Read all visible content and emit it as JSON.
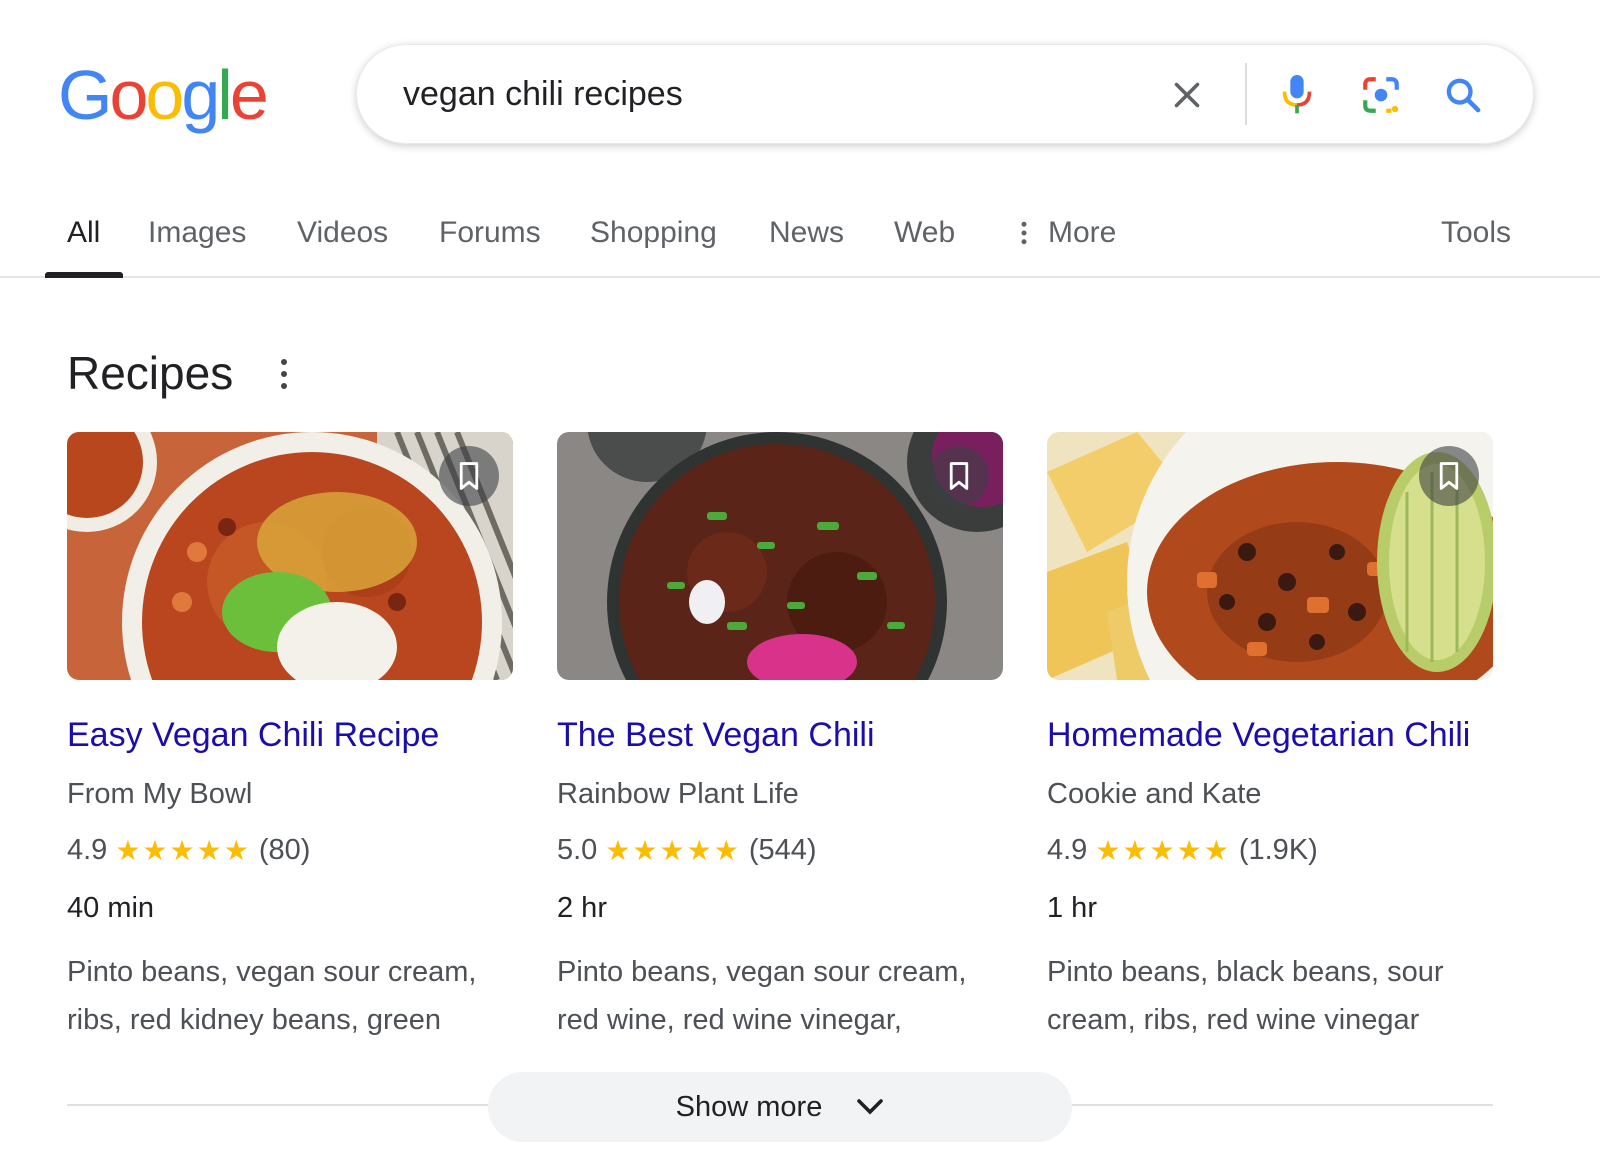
{
  "header": {
    "logo_letters": [
      "G",
      "o",
      "o",
      "g",
      "l",
      "e"
    ],
    "logo_colors": [
      "#4285F4",
      "#EA4335",
      "#FBBC05",
      "#4285F4",
      "#34A853",
      "#EA4335"
    ],
    "search_query": "vegan chili recipes",
    "icons": [
      "close-icon",
      "microphone-icon",
      "lens-camera-icon",
      "search-icon"
    ]
  },
  "tabs": {
    "items": [
      "All",
      "Images",
      "Videos",
      "Forums",
      "Shopping",
      "News",
      "Web",
      "More"
    ],
    "active": "All",
    "tools": "Tools"
  },
  "recipes": {
    "title": "Recipes",
    "cards": [
      {
        "title": "Easy Vegan Chili Recipe",
        "source": "From My Bowl",
        "rating": "4.9",
        "stars": "★★★★★",
        "reviews": "(80)",
        "time": "40 min",
        "ingredients": "Pinto beans, vegan sour cream, ribs, red kidney beans, green"
      },
      {
        "title": "The Best Vegan Chili",
        "source": "Rainbow Plant Life",
        "rating": "5.0",
        "stars": "★★★★★",
        "reviews": "(544)",
        "time": "2 hr",
        "ingredients": "Pinto beans, vegan sour cream, red wine, red wine vinegar,"
      },
      {
        "title": "Homemade Vegetarian Chili",
        "source": "Cookie and Kate",
        "rating": "4.9",
        "stars": "★★★★★",
        "reviews": "(1.9K)",
        "time": "1 hr",
        "ingredients": "Pinto beans, black beans, sour cream, ribs, red wine vinegar"
      }
    ],
    "show_more": "Show more"
  },
  "colors": {
    "link": "#1a0dab",
    "star": "#fbbc04",
    "text_secondary": "#4d5156"
  }
}
